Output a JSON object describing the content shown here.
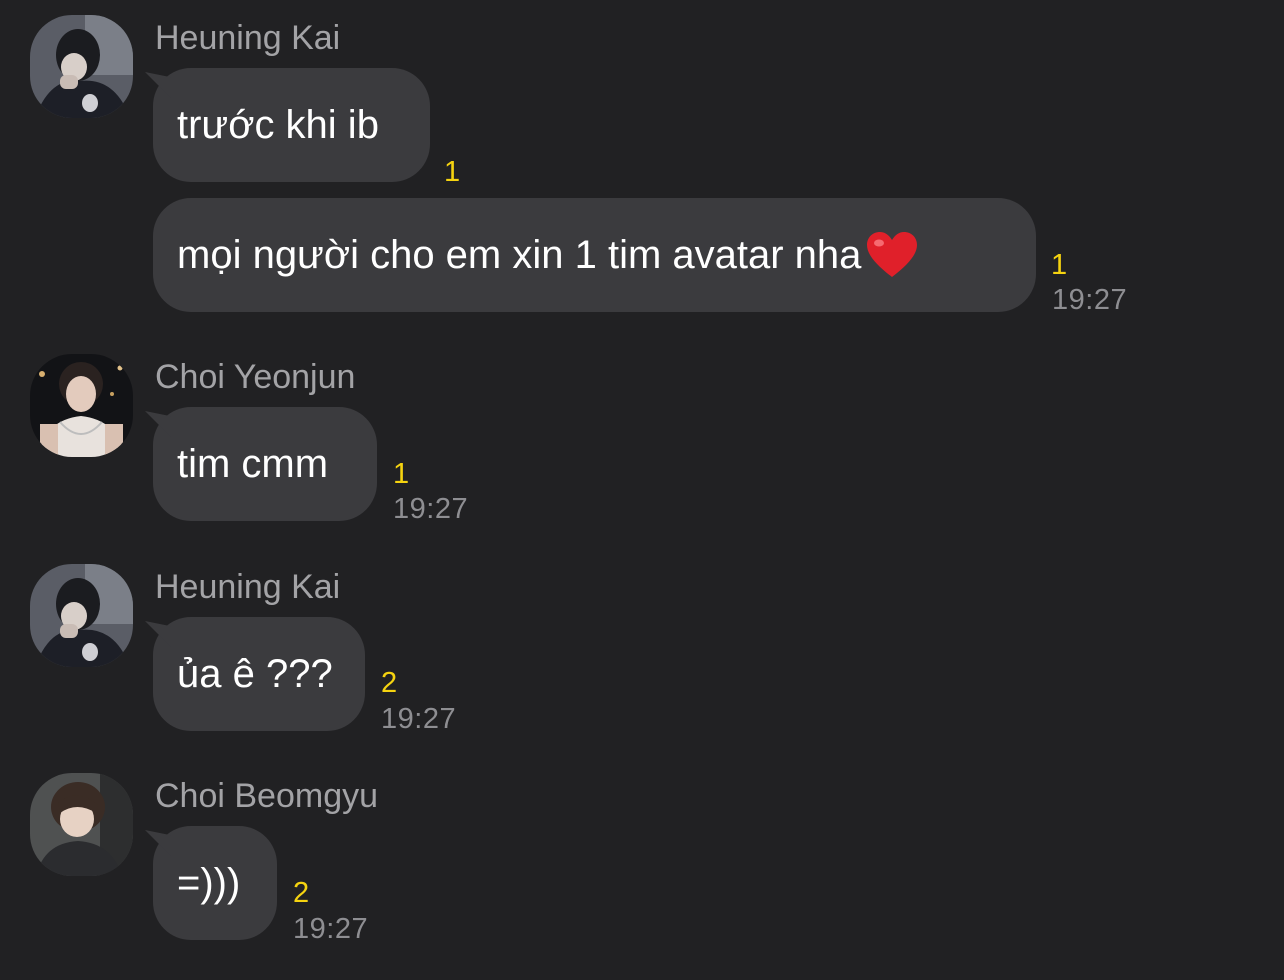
{
  "messages": [
    {
      "sender": "Heuning Kai",
      "text": "trước khi ib",
      "unread": "1",
      "time": ""
    },
    {
      "sender": "",
      "text": "mọi người cho em xin 1 tim avatar nha",
      "emoji": "heart",
      "unread": "1",
      "time": "19:27"
    },
    {
      "sender": "Choi Yeonjun",
      "text": "tim cmm",
      "unread": "1",
      "time": "19:27"
    },
    {
      "sender": "Heuning Kai",
      "text": "ủa ê ???",
      "unread": "2",
      "time": "19:27"
    },
    {
      "sender": "Choi Beomgyu",
      "text": "=)))",
      "unread": "2",
      "time": "19:27"
    }
  ],
  "colors": {
    "background": "#212123",
    "bubble": "#3b3b3e",
    "sender_name": "#a3a3a6",
    "unread_count": "#f5d310",
    "timestamp": "#8e8e92",
    "heart": "#e0202a"
  }
}
